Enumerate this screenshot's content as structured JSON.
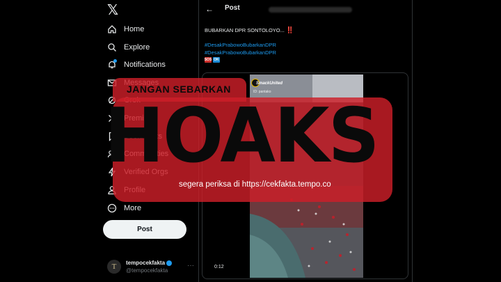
{
  "sidebar": {
    "logo": "𝕏",
    "items": [
      {
        "label": "Home",
        "icon": "home-icon",
        "glyph": "⌂"
      },
      {
        "label": "Explore",
        "icon": "search-icon",
        "glyph": "⚲"
      },
      {
        "label": "Notifications",
        "icon": "bell-icon",
        "glyph": "♫"
      },
      {
        "label": "Messages",
        "icon": "mail-icon",
        "glyph": "✉"
      },
      {
        "label": "Grok",
        "icon": "grok-icon",
        "glyph": "◌"
      },
      {
        "label": "Premium",
        "icon": "x-premium-icon",
        "glyph": "✕"
      },
      {
        "label": "Bookmarks",
        "icon": "bookmark-icon",
        "glyph": "⚑"
      },
      {
        "label": "Communities",
        "icon": "communities-icon",
        "glyph": "☷"
      },
      {
        "label": "Verified Orgs",
        "icon": "lightning-icon",
        "glyph": "ϟ"
      },
      {
        "label": "Profile",
        "icon": "profile-icon",
        "glyph": "☺"
      },
      {
        "label": "More",
        "icon": "more-circle-icon",
        "glyph": "⋯"
      }
    ],
    "post_button": "Post",
    "account": {
      "avatar_letter": "T",
      "name": "tempocekfakta",
      "handle": "@tempocekfakta",
      "more": "···"
    }
  },
  "main": {
    "header": {
      "back": "←",
      "title": "Post"
    },
    "tweet": {
      "text": "BUBARKAN DPR SONTOLOYO...",
      "exclaim": "‼️",
      "hashtags": [
        "#DesakPrabowoBubarkanDPR",
        "#DesakPrabowoBubarkanDPR"
      ],
      "emoji_sos": "SOS",
      "emoji_ok": "OK"
    },
    "video": {
      "timestamp": "0:12",
      "watermark_name": "SmackUnited",
      "watermark_sub": "ID: pantako"
    }
  },
  "stamp": {
    "top": "JANGAN SEBARKAN",
    "word": "HOAKS",
    "bottom": "segera periksa di https://cekfakta.tempo.co"
  },
  "colors": {
    "accent": "#1d9bf0",
    "stamp_red": "#cd1e28",
    "background": "#000000"
  }
}
